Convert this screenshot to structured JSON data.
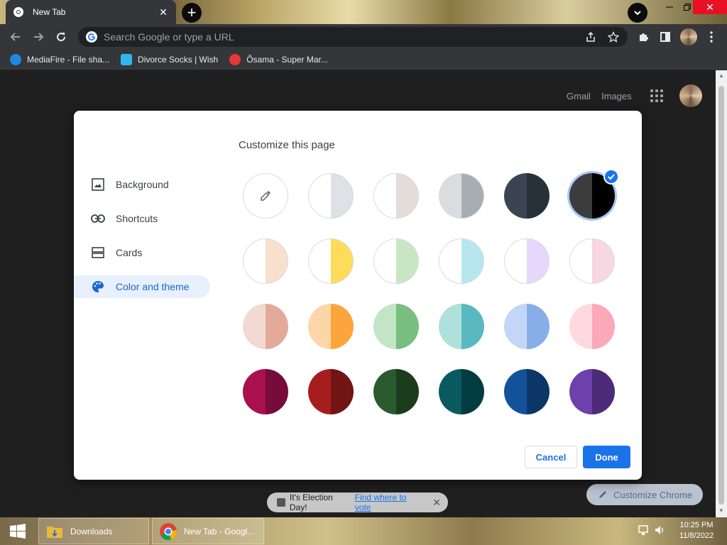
{
  "browser": {
    "tab_title": "New Tab",
    "close_tab_glyph": "✕",
    "new_tab_glyph": "+",
    "window_close_glyph": "✕",
    "omnibox_placeholder": "Search Google or type a URL"
  },
  "bookmarks": [
    {
      "label": "MediaFire - File sha...",
      "icon": "mediafire-icon",
      "color": "#1e88e5"
    },
    {
      "label": "Divorce Socks | Wish",
      "icon": "wish-icon",
      "color": "#2fb7ec"
    },
    {
      "label": "Ôsama - Super Mar...",
      "icon": "mario-icon",
      "color": "#e53935"
    }
  ],
  "ntp": {
    "gmail": "Gmail",
    "images": "Images",
    "election_text": "It's Election Day!",
    "election_link": "Find where to vote",
    "election_close": "✕",
    "customize_chrome": "Customize Chrome"
  },
  "dialog": {
    "title": "Customize this page",
    "nav": [
      {
        "label": "Background",
        "icon": "image-icon"
      },
      {
        "label": "Shortcuts",
        "icon": "link-icon"
      },
      {
        "label": "Cards",
        "icon": "cards-icon"
      },
      {
        "label": "Color and theme",
        "icon": "palette-icon",
        "active": true
      }
    ],
    "swatches": [
      {
        "name": "custom-color",
        "left": "#ffffff",
        "right": "#ffffff",
        "custom": true
      },
      {
        "name": "default-light",
        "left": "#ffffff",
        "right": "#dee1e6"
      },
      {
        "name": "beige-white",
        "left": "#ffffff",
        "right": "#e3dcd9"
      },
      {
        "name": "light-grey",
        "left": "#dadce0",
        "right": "#a8acb3"
      },
      {
        "name": "cool-grey",
        "left": "#3b4551",
        "right": "#27313a"
      },
      {
        "name": "black",
        "left": "#3c3c3c",
        "right": "#000000",
        "selected": true
      },
      {
        "name": "beige-and-white",
        "left": "#ffffff",
        "right": "#f9dfcd"
      },
      {
        "name": "yellow-and-white",
        "left": "#ffffff",
        "right": "#fddc5a"
      },
      {
        "name": "green-and-white",
        "left": "#ffffff",
        "right": "#c8e6c2"
      },
      {
        "name": "light-teal-and-white",
        "left": "#ffffff",
        "right": "#b8e6ee"
      },
      {
        "name": "light-purple-and-white",
        "left": "#ffffff",
        "right": "#e6d7fb"
      },
      {
        "name": "pink-and-white",
        "left": "#ffffff",
        "right": "#f6d7e2"
      },
      {
        "name": "beige",
        "left": "#f1dad2",
        "right": "#e3aa9a"
      },
      {
        "name": "orange",
        "left": "#fcd6a8",
        "right": "#fca53d"
      },
      {
        "name": "light-green",
        "left": "#c4e4c6",
        "right": "#78be7e"
      },
      {
        "name": "light-teal",
        "left": "#aee0dc",
        "right": "#5ab9c0"
      },
      {
        "name": "light-blue",
        "left": "#c4d6f5",
        "right": "#88aee8"
      },
      {
        "name": "light-pink",
        "left": "#ffd9df",
        "right": "#fba8b9"
      },
      {
        "name": "dark-pink-and-red",
        "left": "#a9104d",
        "right": "#770c3a"
      },
      {
        "name": "dark-red-and-orange",
        "left": "#a51d1e",
        "right": "#711414"
      },
      {
        "name": "dark-green",
        "left": "#2a5a2e",
        "right": "#1b3c1d"
      },
      {
        "name": "dark-teal",
        "left": "#085a5e",
        "right": "#023c40"
      },
      {
        "name": "dark-blue",
        "left": "#13529b",
        "right": "#0c3666"
      },
      {
        "name": "purple",
        "left": "#6e40aa",
        "right": "#4d2b78"
      }
    ],
    "cancel": "Cancel",
    "done": "Done"
  },
  "taskbar": {
    "items": [
      {
        "label": "Downloads",
        "icon": "folder-icon"
      },
      {
        "label": "New Tab - Googl...",
        "icon": "chrome-icon"
      }
    ],
    "time": "10:25 PM",
    "date": "11/8/2022"
  },
  "colors": {
    "accent": "#1a73e8",
    "page_bg": "#1f1f1f",
    "toolbar_bg": "#35363a"
  }
}
